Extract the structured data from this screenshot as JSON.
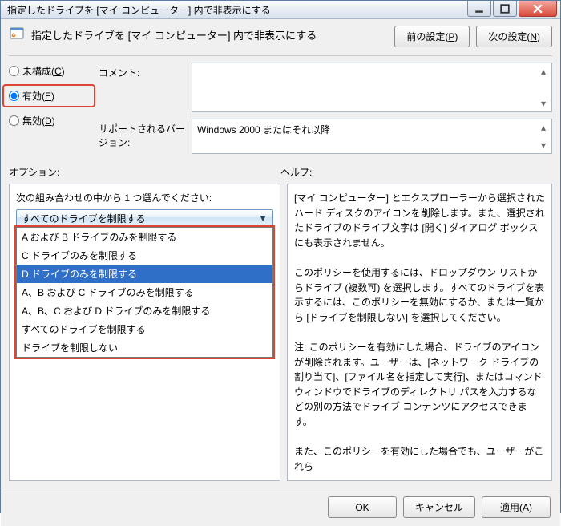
{
  "titlebar": "指定したドライブを [マイ コンピューター] 内で非表示にする",
  "header": {
    "title": "指定したドライブを [マイ コンピューター] 内で非表示にする",
    "prev": "前の設定(P)",
    "next": "次の設定(N)"
  },
  "radios": {
    "not_configured": "未構成(C)",
    "enabled": "有効(E)",
    "disabled": "無効(D)",
    "selected": "enabled"
  },
  "fields": {
    "comment_label": "コメント:",
    "version_label": "サポートされるバージョン:",
    "version_value": "Windows 2000 またはそれ以降"
  },
  "sections": {
    "options": "オプション:",
    "help": "ヘルプ:"
  },
  "options": {
    "prompt": "次の組み合わせの中から 1 つ選んでください:",
    "selected_label": "すべてのドライブを制限する",
    "items": [
      "A および B ドライブのみを制限する",
      "C ドライブのみを制限する",
      "D ドライブのみを制限する",
      "A、B および C ドライブのみを制限する",
      "A、B、C および D ドライブのみを制限する",
      "すべてのドライブを制限する",
      "ドライブを制限しない"
    ],
    "highlighted_index": 2
  },
  "help_text": "[マイ コンピューター] とエクスプローラーから選択されたハード ディスクのアイコンを削除します。また、選択されたドライブのドライブ文字は [開く] ダイアログ ボックスにも表示されません。\n\nこのポリシーを使用するには、ドロップダウン リストからドライブ (複数可) を選択します。すべてのドライブを表示するには、このポリシーを無効にするか、または一覧から [ドライブを制限しない] を選択してください。\n\n注: このポリシーを有効にした場合、ドライブのアイコンが削除されます。ユーザーは、[ネットワーク ドライブの割り当て]、[ファイル名を指定して実行]、またはコマンド ウィンドウでドライブのディレクトリ パスを入力するなどの別の方法でドライブ コンテンツにアクセスできます。\n\nまた、このポリシーを有効にした場合でも、ユーザーがこれら",
  "footer": {
    "ok": "OK",
    "cancel": "キャンセル",
    "apply": "適用(A)"
  }
}
